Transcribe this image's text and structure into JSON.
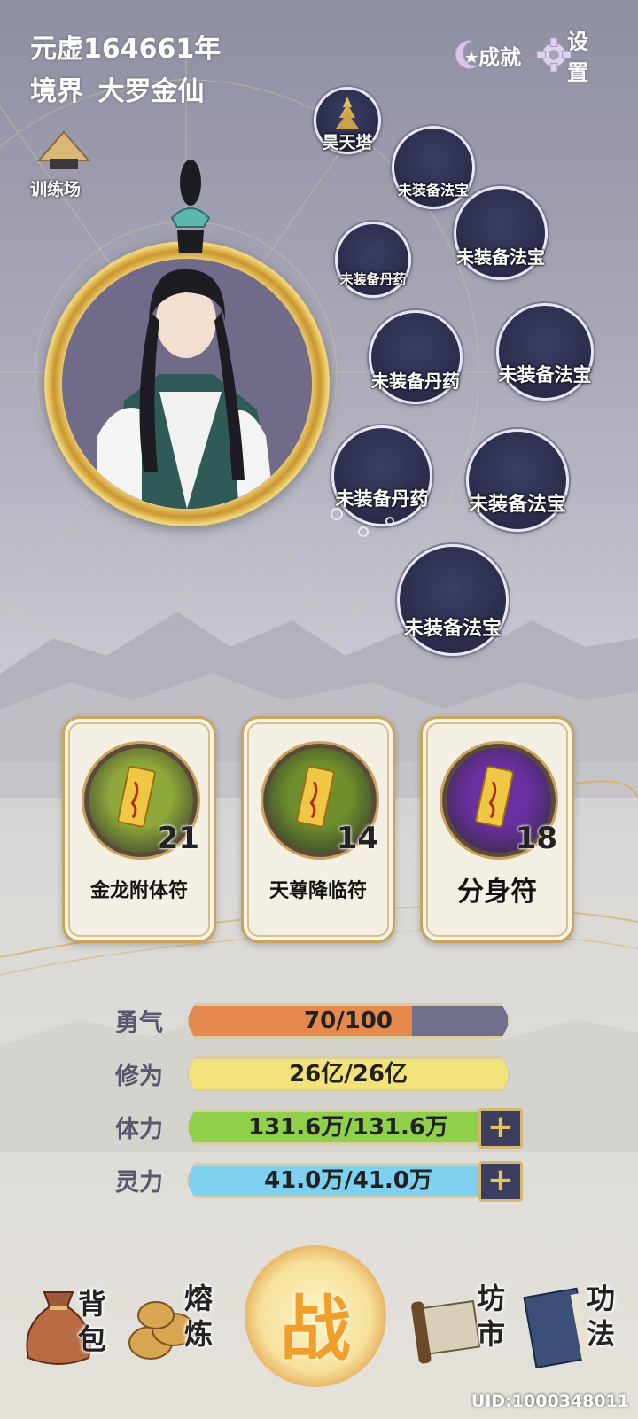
{
  "header": {
    "era": "元虚164661年",
    "realm_label": "境界",
    "realm_value": "大罗金仙"
  },
  "top_buttons": {
    "achievement": "成就",
    "settings": "设置"
  },
  "training": {
    "label": "训练场"
  },
  "treasure": {
    "label": "昊天塔"
  },
  "slots": [
    "未装备法宝",
    "未装备法宝",
    "未装备丹药",
    "未装备丹药",
    "未装备法宝",
    "未装备丹药",
    "未装备法宝",
    "未装备法宝"
  ],
  "talismans": [
    {
      "name": "金龙附体符",
      "count": "21",
      "color": "#8ea83a"
    },
    {
      "name": "天尊降临符",
      "count": "14",
      "color": "#6e8f2c"
    },
    {
      "name": "分身符",
      "count": "18",
      "color": "#6a2fa0"
    }
  ],
  "stats": [
    {
      "label": "勇气",
      "value": "70/100",
      "fill": 0.7,
      "color": "#e58a4c",
      "plus": false
    },
    {
      "label": "修为",
      "value": "26亿/26亿",
      "fill": 1.0,
      "color": "#f1e37a",
      "plus": false
    },
    {
      "label": "体力",
      "value": "131.6万/131.6万",
      "fill": 1.0,
      "color": "#8fd14a",
      "plus": true
    },
    {
      "label": "灵力",
      "value": "41.0万/41.0万",
      "fill": 1.0,
      "color": "#7fd0ee",
      "plus": true
    }
  ],
  "nav": {
    "bag_l1": "背",
    "bag_l2": "包",
    "smelt_l1": "熔",
    "smelt_l2": "炼",
    "battle": "战",
    "market_l1": "坊",
    "market_l2": "市",
    "skills_l1": "功",
    "skills_l2": "法"
  },
  "uid": "UID:1000348011",
  "colors": {
    "gold": "#caa25a",
    "battle_text": "#f0a02a"
  }
}
